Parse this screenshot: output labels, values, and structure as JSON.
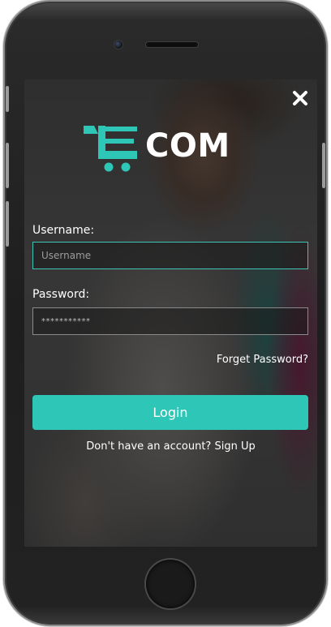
{
  "app": {
    "logo_text": "COM",
    "accent_color": "#2ec7b7"
  },
  "icons": {
    "close": "close-icon",
    "logo": "shopping-cart-e-logo-icon"
  },
  "form": {
    "username_label": "Username:",
    "username_placeholder": "Username",
    "username_value": "",
    "password_label": "Password:",
    "password_value": "***********",
    "forgot_password": "Forget Password?",
    "login_label": "Login",
    "signup_prompt": "Don't have an account?",
    "signup_link": "Sign Up"
  }
}
